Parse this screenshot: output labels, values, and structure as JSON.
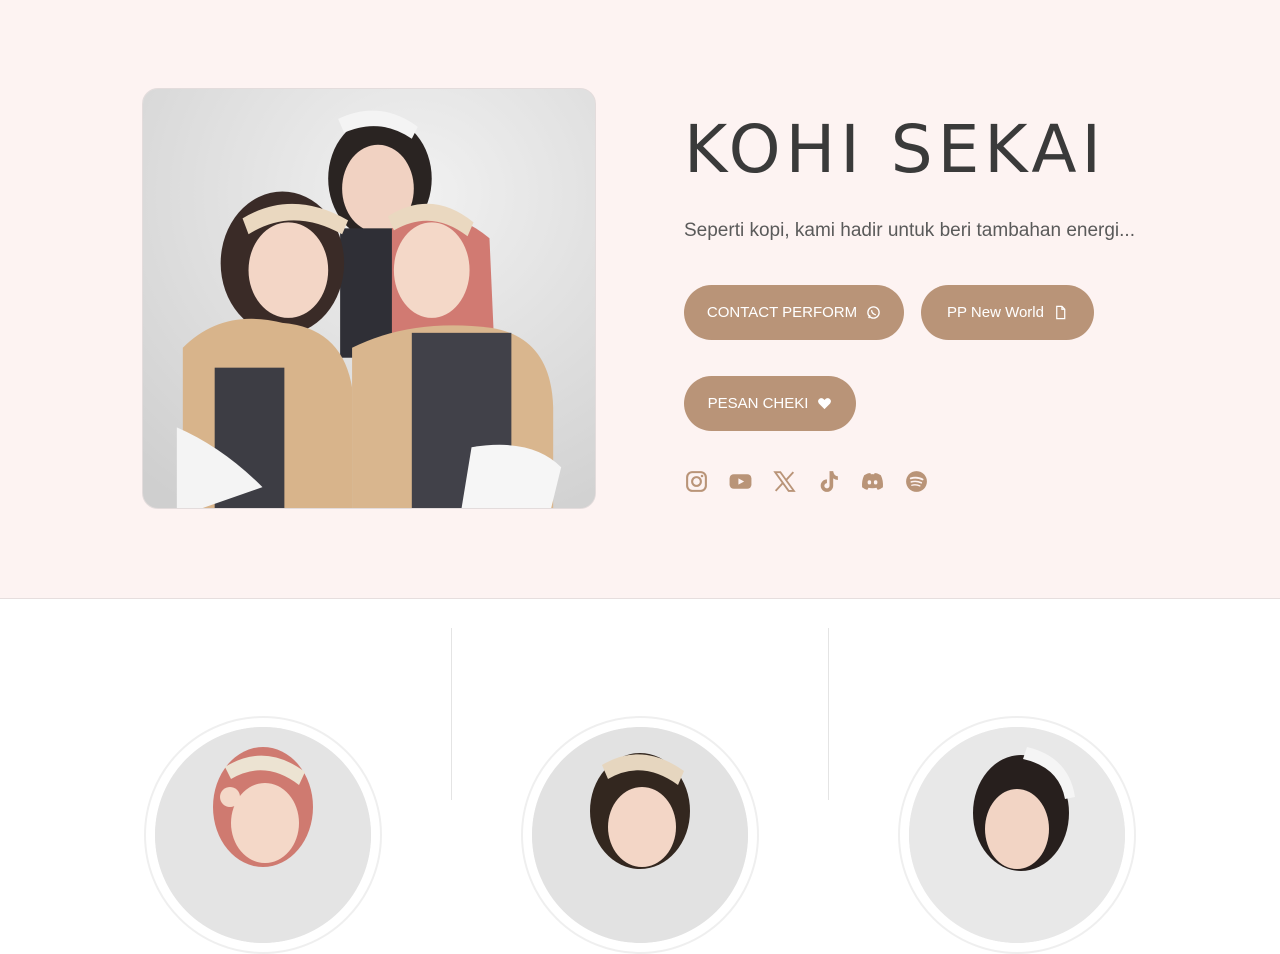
{
  "hero": {
    "title": "KOHI SEKAI",
    "tagline": "Seperti kopi, kami hadir untuk beri tambahan energi...",
    "photo_alt": "group-photo",
    "buttons": [
      {
        "label": "CONTACT PERFORM",
        "icon": "whatsapp-icon"
      },
      {
        "label": "PP New World",
        "icon": "document-icon"
      },
      {
        "label": "PESAN CHEKI",
        "icon": "heart-icon"
      }
    ],
    "socials": [
      "instagram-icon",
      "youtube-icon",
      "x-icon",
      "tiktok-icon",
      "discord-icon",
      "spotify-icon"
    ]
  },
  "members": {
    "cards": [
      "member-avatar-1",
      "member-avatar-2",
      "member-avatar-3"
    ]
  },
  "colors": {
    "hero_bg": "#fdf3f2",
    "button": "#b99478",
    "icon": "#b99478",
    "title": "#3a3a3a"
  }
}
